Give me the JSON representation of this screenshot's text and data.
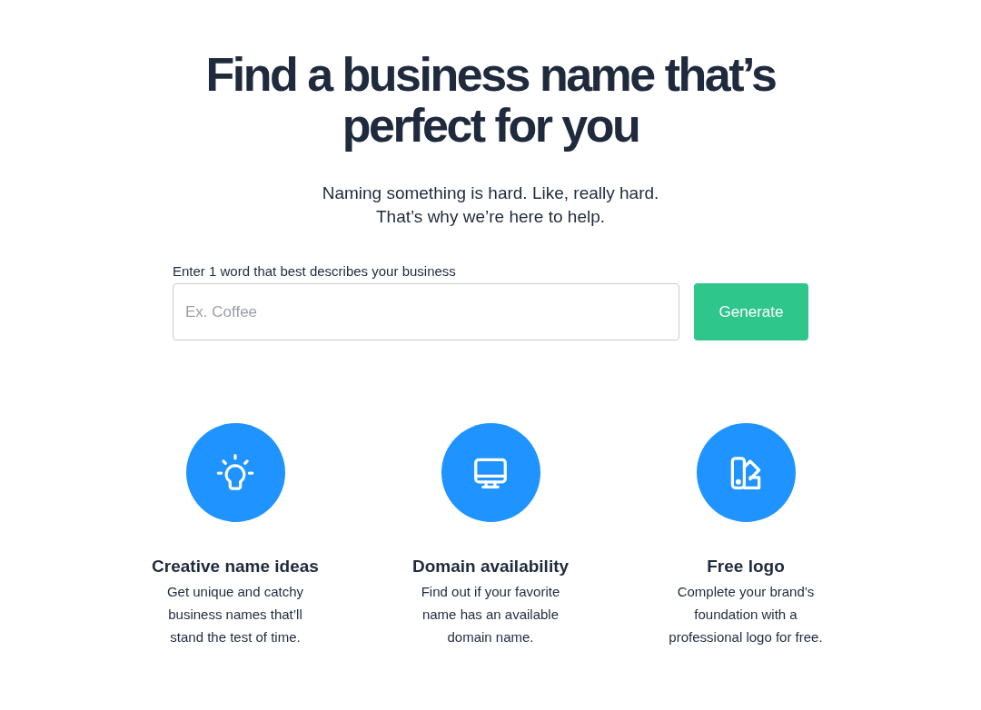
{
  "headline": [
    "Find a business name that’s",
    "perfect for you"
  ],
  "subtitle": [
    "Naming something is hard. Like, really hard.",
    "That’s why we’re here to help."
  ],
  "search": {
    "label": "Enter 1 word that best describes your business",
    "placeholder": "Ex. Coffee",
    "button": "Generate"
  },
  "features": [
    {
      "kind": "idea",
      "title": "Creative name ideas",
      "description": [
        "Get unique and catchy",
        "business names that’ll",
        "stand the test of time."
      ]
    },
    {
      "kind": "domain",
      "title": "Domain availability",
      "description": [
        "Find out if your favorite",
        "name has an available",
        "domain name."
      ]
    },
    {
      "kind": "logo",
      "title": "Free logo",
      "description": [
        "Complete your brand’s",
        "foundation with a",
        "professional logo for free."
      ]
    }
  ]
}
